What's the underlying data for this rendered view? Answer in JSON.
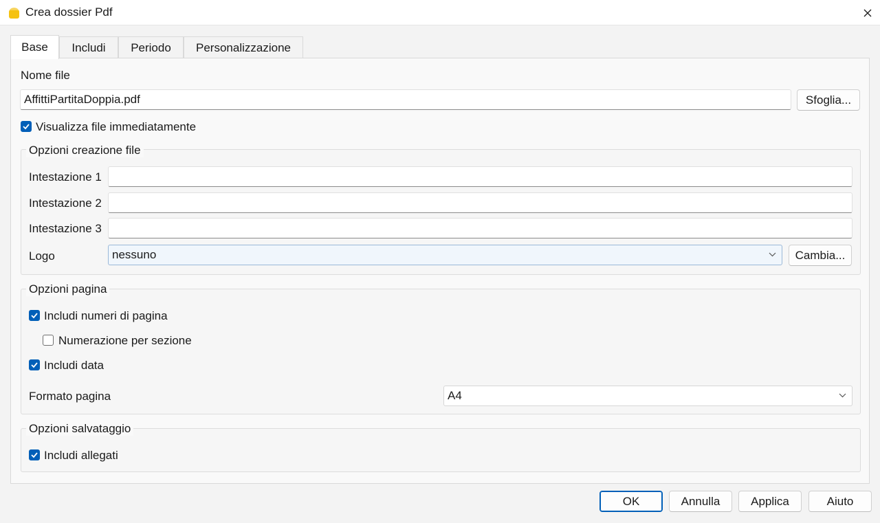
{
  "window": {
    "title": "Crea dossier Pdf"
  },
  "tabs": [
    {
      "label": "Base",
      "active": true
    },
    {
      "label": "Includi",
      "active": false
    },
    {
      "label": "Periodo",
      "active": false
    },
    {
      "label": "Personalizzazione",
      "active": false
    }
  ],
  "base": {
    "file_name_label": "Nome file",
    "file_name_value": "AffittiPartitaDoppia.pdf",
    "browse_label": "Sfoglia...",
    "show_file_label": "Visualizza file immediatamente",
    "show_file_checked": true
  },
  "creation_options": {
    "title": "Opzioni creazione file",
    "header1_label": "Intestazione 1",
    "header1_value": "",
    "header2_label": "Intestazione 2",
    "header2_value": "",
    "header3_label": "Intestazione 3",
    "header3_value": "",
    "logo_label": "Logo",
    "logo_value": "nessuno",
    "change_label": "Cambia..."
  },
  "page_options": {
    "title": "Opzioni pagina",
    "page_numbers_label": "Includi numeri di pagina",
    "page_numbers_checked": true,
    "section_numbering_label": "Numerazione per sezione",
    "section_numbering_checked": false,
    "include_date_label": "Includi data",
    "include_date_checked": true,
    "page_format_label": "Formato pagina",
    "page_format_value": "A4"
  },
  "save_options": {
    "title": "Opzioni salvataggio",
    "attachments_label": "Includi allegati",
    "attachments_checked": true
  },
  "footer": {
    "ok_label": "OK",
    "cancel_label": "Annulla",
    "apply_label": "Applica",
    "help_label": "Aiuto"
  },
  "colors": {
    "accent": "#005fb8",
    "icon_yellow": "#f5c211"
  }
}
